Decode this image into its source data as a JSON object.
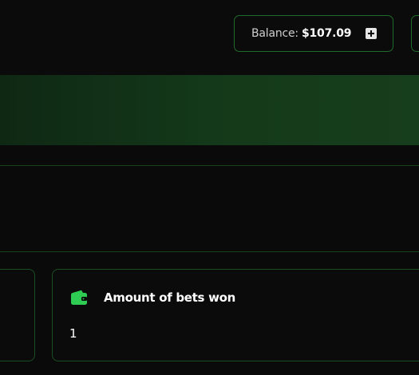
{
  "header": {
    "balance_label": "Balance:",
    "balance_value": "$107.09",
    "add_icon": "plus-square-icon"
  },
  "stats": {
    "bets_won": {
      "icon": "wallet-icon",
      "title": "Amount of bets won",
      "value": "1"
    }
  },
  "colors": {
    "accent_green": "#1f6b2a",
    "icon_green": "#2ecc52",
    "background": "#0a0a0a",
    "banner_green": "#143a1a"
  }
}
